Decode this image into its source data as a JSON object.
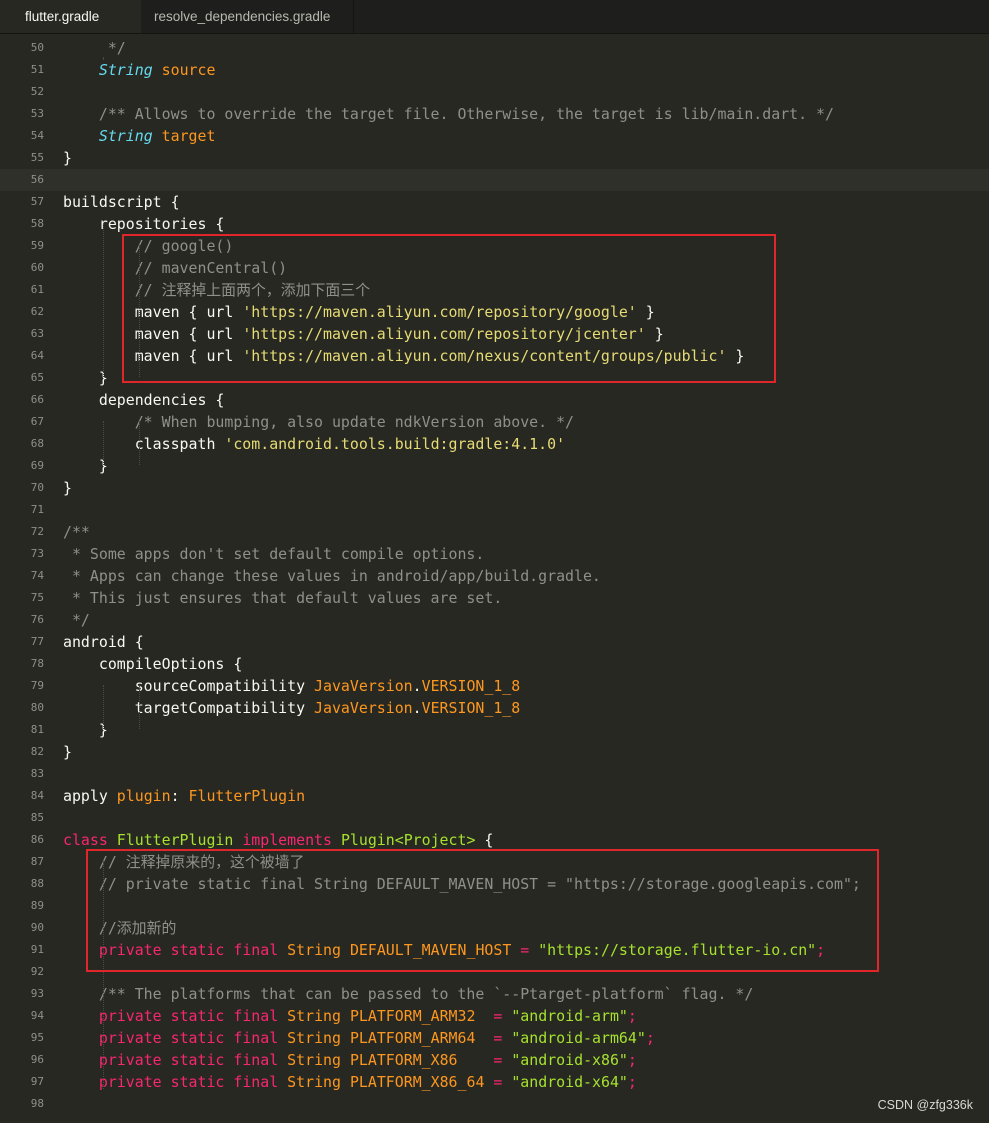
{
  "tabs": [
    {
      "label": "flutter.gradle",
      "active": true
    },
    {
      "label": "resolve_dependencies.gradle",
      "active": false
    }
  ],
  "editor": {
    "theme": {
      "background": "#272822",
      "highlight_box": "#e0262b"
    },
    "lines": [
      {
        "num": "50",
        "tokens": [
          [
            "     */",
            "com"
          ]
        ]
      },
      {
        "num": "51",
        "tokens": [
          [
            "    ",
            "plain"
          ],
          [
            "String",
            "type"
          ],
          [
            " ",
            "plain"
          ],
          [
            "source",
            "prop"
          ]
        ]
      },
      {
        "num": "52",
        "tokens": []
      },
      {
        "num": "53",
        "tokens": [
          [
            "    /** Allows to override the target file. Otherwise, the target is lib/main.dart. */",
            "com"
          ]
        ]
      },
      {
        "num": "54",
        "tokens": [
          [
            "    ",
            "plain"
          ],
          [
            "String",
            "type"
          ],
          [
            " ",
            "plain"
          ],
          [
            "target",
            "prop"
          ]
        ]
      },
      {
        "num": "55",
        "tokens": [
          [
            "}",
            "plain"
          ]
        ]
      },
      {
        "num": "56",
        "tokens": [],
        "current": true
      },
      {
        "num": "57",
        "tokens": [
          [
            "buildscript {",
            "plain"
          ]
        ]
      },
      {
        "num": "58",
        "tokens": [
          [
            "    repositories {",
            "plain"
          ]
        ]
      },
      {
        "num": "59",
        "tokens": [
          [
            "        // google()",
            "com"
          ]
        ]
      },
      {
        "num": "60",
        "tokens": [
          [
            "        // mavenCentral()",
            "com"
          ]
        ]
      },
      {
        "num": "61",
        "tokens": [
          [
            "        // 注释掉上面两个，添加下面三个",
            "com"
          ]
        ]
      },
      {
        "num": "62",
        "tokens": [
          [
            "        maven { url ",
            "plain"
          ],
          [
            "'https://maven.aliyun.com/repository/google'",
            "str"
          ],
          [
            " }",
            "plain"
          ]
        ]
      },
      {
        "num": "63",
        "tokens": [
          [
            "        maven { url ",
            "plain"
          ],
          [
            "'https://maven.aliyun.com/repository/jcenter'",
            "str"
          ],
          [
            " }",
            "plain"
          ]
        ]
      },
      {
        "num": "64",
        "tokens": [
          [
            "        maven { url ",
            "plain"
          ],
          [
            "'https://maven.aliyun.com/nexus/content/groups/public'",
            "str"
          ],
          [
            " }",
            "plain"
          ]
        ]
      },
      {
        "num": "65",
        "tokens": [
          [
            "    }",
            "plain"
          ]
        ]
      },
      {
        "num": "66",
        "tokens": [
          [
            "    dependencies {",
            "plain"
          ]
        ]
      },
      {
        "num": "67",
        "tokens": [
          [
            "        /* When bumping, also update ndkVersion above. */",
            "com"
          ]
        ]
      },
      {
        "num": "68",
        "tokens": [
          [
            "        classpath ",
            "plain"
          ],
          [
            "'com.android.tools.build:gradle:4.1.0'",
            "str"
          ]
        ]
      },
      {
        "num": "69",
        "tokens": [
          [
            "    }",
            "plain"
          ]
        ]
      },
      {
        "num": "70",
        "tokens": [
          [
            "}",
            "plain"
          ]
        ]
      },
      {
        "num": "71",
        "tokens": []
      },
      {
        "num": "72",
        "tokens": [
          [
            "/**",
            "com"
          ]
        ]
      },
      {
        "num": "73",
        "tokens": [
          [
            " * Some apps don't set default compile options.",
            "com"
          ]
        ]
      },
      {
        "num": "74",
        "tokens": [
          [
            " * Apps can change these values in android/app/build.gradle.",
            "com"
          ]
        ]
      },
      {
        "num": "75",
        "tokens": [
          [
            " * This just ensures that default values are set.",
            "com"
          ]
        ]
      },
      {
        "num": "76",
        "tokens": [
          [
            " */",
            "com"
          ]
        ]
      },
      {
        "num": "77",
        "tokens": [
          [
            "android {",
            "plain"
          ]
        ]
      },
      {
        "num": "78",
        "tokens": [
          [
            "    compileOptions {",
            "plain"
          ]
        ]
      },
      {
        "num": "79",
        "tokens": [
          [
            "        sourceCompatibility ",
            "plain"
          ],
          [
            "JavaVersion",
            "prop"
          ],
          [
            ".",
            "plain"
          ],
          [
            "VERSION_1_8",
            "prop"
          ]
        ]
      },
      {
        "num": "80",
        "tokens": [
          [
            "        targetCompatibility ",
            "plain"
          ],
          [
            "JavaVersion",
            "prop"
          ],
          [
            ".",
            "plain"
          ],
          [
            "VERSION_1_8",
            "prop"
          ]
        ]
      },
      {
        "num": "81",
        "tokens": [
          [
            "    }",
            "plain"
          ]
        ]
      },
      {
        "num": "82",
        "tokens": [
          [
            "}",
            "plain"
          ]
        ]
      },
      {
        "num": "83",
        "tokens": []
      },
      {
        "num": "84",
        "tokens": [
          [
            "apply ",
            "plain"
          ],
          [
            "plugin",
            "prop"
          ],
          [
            ": ",
            "plain"
          ],
          [
            "FlutterPlugin",
            "prop"
          ]
        ]
      },
      {
        "num": "85",
        "tokens": []
      },
      {
        "num": "86",
        "tokens": [
          [
            "class",
            "kw"
          ],
          [
            " ",
            "plain"
          ],
          [
            "FlutterPlugin",
            "cls"
          ],
          [
            " ",
            "plain"
          ],
          [
            "implements",
            "kw"
          ],
          [
            " ",
            "plain"
          ],
          [
            "Plugin<Project>",
            "cls"
          ],
          [
            " {",
            "plain"
          ]
        ]
      },
      {
        "num": "87",
        "tokens": [
          [
            "    // 注释掉原来的，这个被墙了",
            "com"
          ]
        ]
      },
      {
        "num": "88",
        "tokens": [
          [
            "    // private static final String DEFAULT_MAVEN_HOST = \"https://storage.googleapis.com\";",
            "com"
          ]
        ]
      },
      {
        "num": "89",
        "tokens": []
      },
      {
        "num": "90",
        "tokens": [
          [
            "    //添加新的",
            "com"
          ]
        ]
      },
      {
        "num": "91",
        "tokens": [
          [
            "    ",
            "plain"
          ],
          [
            "private",
            "kw"
          ],
          [
            " ",
            "plain"
          ],
          [
            "static",
            "kw"
          ],
          [
            " ",
            "plain"
          ],
          [
            "final",
            "kw"
          ],
          [
            " ",
            "plain"
          ],
          [
            "String",
            "prop"
          ],
          [
            " ",
            "plain"
          ],
          [
            "DEFAULT_MAVEN_HOST",
            "prop"
          ],
          [
            " ",
            "plain"
          ],
          [
            "=",
            "kw"
          ],
          [
            " ",
            "plain"
          ],
          [
            "\"https://storage.flutter-io.cn\"",
            "str-alt"
          ],
          [
            ";",
            "kw"
          ]
        ]
      },
      {
        "num": "92",
        "tokens": []
      },
      {
        "num": "93",
        "tokens": [
          [
            "    /** The platforms that can be passed to the `--Ptarget-platform` flag. */",
            "com"
          ]
        ]
      },
      {
        "num": "94",
        "tokens": [
          [
            "    ",
            "plain"
          ],
          [
            "private",
            "kw"
          ],
          [
            " ",
            "plain"
          ],
          [
            "static",
            "kw"
          ],
          [
            " ",
            "plain"
          ],
          [
            "final",
            "kw"
          ],
          [
            " ",
            "plain"
          ],
          [
            "String",
            "prop"
          ],
          [
            " ",
            "plain"
          ],
          [
            "PLATFORM_ARM32",
            "prop"
          ],
          [
            "  ",
            "plain"
          ],
          [
            "=",
            "kw"
          ],
          [
            " ",
            "plain"
          ],
          [
            "\"android-arm\"",
            "str-alt"
          ],
          [
            ";",
            "kw"
          ]
        ]
      },
      {
        "num": "95",
        "tokens": [
          [
            "    ",
            "plain"
          ],
          [
            "private",
            "kw"
          ],
          [
            " ",
            "plain"
          ],
          [
            "static",
            "kw"
          ],
          [
            " ",
            "plain"
          ],
          [
            "final",
            "kw"
          ],
          [
            " ",
            "plain"
          ],
          [
            "String",
            "prop"
          ],
          [
            " ",
            "plain"
          ],
          [
            "PLATFORM_ARM64",
            "prop"
          ],
          [
            "  ",
            "plain"
          ],
          [
            "=",
            "kw"
          ],
          [
            " ",
            "plain"
          ],
          [
            "\"android-arm64\"",
            "str-alt"
          ],
          [
            ";",
            "kw"
          ]
        ]
      },
      {
        "num": "96",
        "tokens": [
          [
            "    ",
            "plain"
          ],
          [
            "private",
            "kw"
          ],
          [
            " ",
            "plain"
          ],
          [
            "static",
            "kw"
          ],
          [
            " ",
            "plain"
          ],
          [
            "final",
            "kw"
          ],
          [
            " ",
            "plain"
          ],
          [
            "String",
            "prop"
          ],
          [
            " ",
            "plain"
          ],
          [
            "PLATFORM_X86",
            "prop"
          ],
          [
            "    ",
            "plain"
          ],
          [
            "=",
            "kw"
          ],
          [
            " ",
            "plain"
          ],
          [
            "\"android-x86\"",
            "str-alt"
          ],
          [
            ";",
            "kw"
          ]
        ]
      },
      {
        "num": "97",
        "tokens": [
          [
            "    ",
            "plain"
          ],
          [
            "private",
            "kw"
          ],
          [
            " ",
            "plain"
          ],
          [
            "static",
            "kw"
          ],
          [
            " ",
            "plain"
          ],
          [
            "final",
            "kw"
          ],
          [
            " ",
            "plain"
          ],
          [
            "String",
            "prop"
          ],
          [
            " ",
            "plain"
          ],
          [
            "PLATFORM_X86_64",
            "prop"
          ],
          [
            " ",
            "plain"
          ],
          [
            "=",
            "kw"
          ],
          [
            " ",
            "plain"
          ],
          [
            "\"android-x64\"",
            "str-alt"
          ],
          [
            ";",
            "kw"
          ]
        ]
      },
      {
        "num": "98",
        "tokens": []
      }
    ]
  },
  "watermark": "CSDN @zfg336k"
}
